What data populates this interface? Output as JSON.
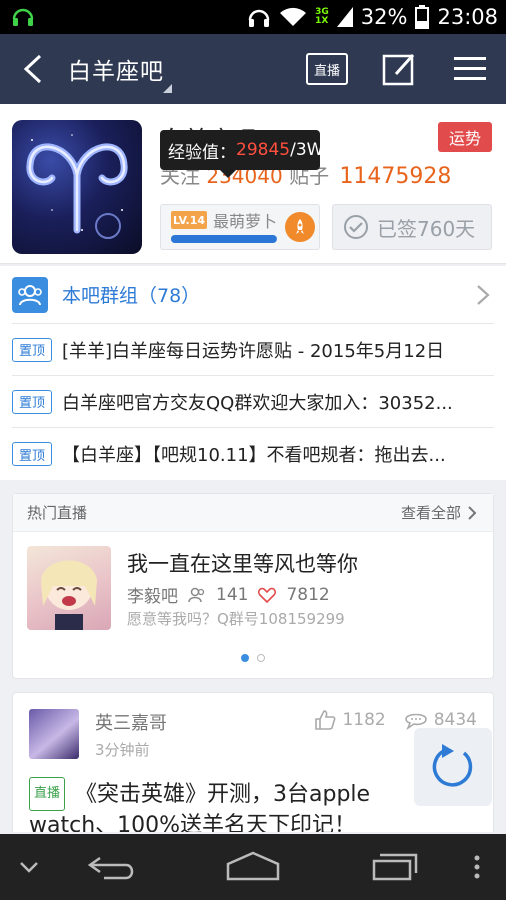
{
  "status_bar": {
    "battery_text": "32%",
    "time": "23:08",
    "network_top": "3G",
    "network_bottom": "1X"
  },
  "nav": {
    "title": "白羊座吧",
    "live_button": "直播"
  },
  "header": {
    "forum_name": "白羊座吧",
    "tooltip_label": "经验值：",
    "tooltip_value": "29845",
    "tooltip_total": "/3W",
    "stats_prefix": "关注",
    "member_count": "234040",
    "posts_label": "贴子",
    "post_count": "11475928",
    "luck_button": "运势",
    "level_badge": "LV.14",
    "level_name": "最萌萝卜",
    "level_progress": 0.99,
    "signed_label": "已签760天"
  },
  "group": {
    "label": "本吧群组（78）"
  },
  "sticky_posts": [
    {
      "tag": "置顶",
      "text": "[羊羊]白羊座每日运势许愿贴 - 2015年5月12日"
    },
    {
      "tag": "置顶",
      "text": "白羊座吧官方交友QQ群欢迎大家加入：30352..."
    },
    {
      "tag": "置顶",
      "text": "【白羊座】【吧规10.11】不看吧规者：拖出去..."
    }
  ],
  "hot_live": {
    "section_title": "热门直播",
    "view_all": "查看全部",
    "title": "我一直在这里等风也等你",
    "host": "李毅吧",
    "viewers": "141",
    "likes": "7812",
    "description": "愿意等我吗？Q群号108159299"
  },
  "thread": {
    "user": "英三嘉哥",
    "time": "3分钟前",
    "likes": "1182",
    "comments": "8434",
    "tag": "直播",
    "text": "《突击英雄》开测，3台apple watch、100%送羊名天下印记！"
  },
  "colors": {
    "nav_bg": "#2f3a52",
    "accent_blue": "#3b8de0",
    "accent_orange": "#e8641c",
    "luck_red": "#e24b4b"
  }
}
